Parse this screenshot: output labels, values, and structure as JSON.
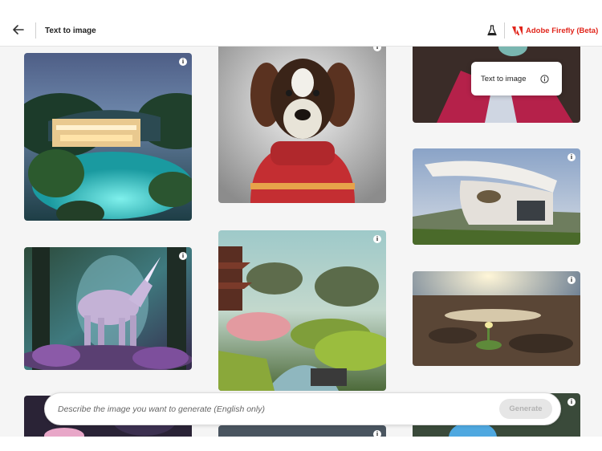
{
  "header": {
    "title": "Text to image",
    "brand": "Adobe Firefly (Beta)",
    "brand_color": "#e1251b",
    "back_icon": "arrow-left-icon",
    "labs_icon": "flask-icon"
  },
  "tooltip": {
    "text": "Text to image",
    "icon": "info-circle-icon"
  },
  "tile_info_symbol": "i",
  "prompt": {
    "placeholder": "Describe the image you want to generate (English only)",
    "value": "",
    "generate_label": "Generate"
  }
}
